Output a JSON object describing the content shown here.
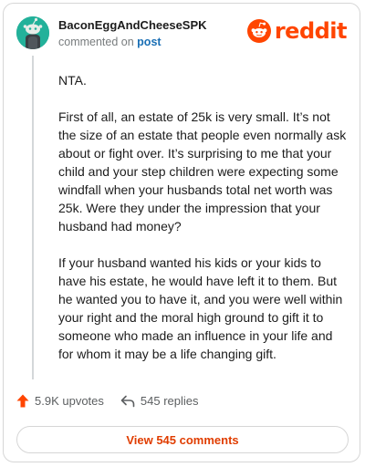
{
  "comment": {
    "author": "BaconEggAndCheeseSPK",
    "commented_on": "commented on",
    "post_link": "post",
    "paragraphs": [
      "NTA.",
      "First of all, an estate of 25k is very small. It’s not the size of an estate that people even normally ask about or fight over. It’s surprising to me that your child and your step children were expecting some windfall when your husbands total net worth was 25k. Were they under the impression that your husband had money?",
      "If your husband wanted his kids or your kids to have his estate, he would have left it to them. But he wanted you to have it, and you were well within your right and the moral high ground to gift it to someone who made an influence in your life and for whom it may be a life changing gift."
    ]
  },
  "brand": {
    "name": "reddit",
    "icon": "reddit-snoo-icon",
    "color": "#ff4500"
  },
  "actions": {
    "upvotes_label": "5.9K upvotes",
    "upvote_icon": "upvote-arrow-icon",
    "upvote_color": "#ff4500",
    "replies_label": "545 replies",
    "reply_icon": "reply-arrow-icon"
  },
  "footer": {
    "view_comments_label": "View 545 comments"
  }
}
